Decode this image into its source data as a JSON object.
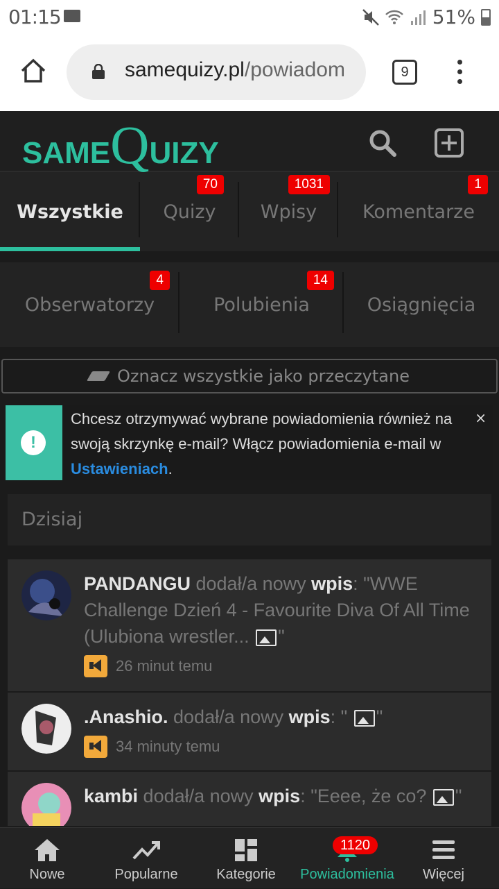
{
  "status_bar": {
    "time": "01:15",
    "battery": "51%"
  },
  "browser": {
    "url_domain": "samequizy.pl",
    "url_path": "/powiadom",
    "tab_count": "9"
  },
  "site": {
    "logo_same": "SAME",
    "logo_q": "Q",
    "logo_rest": "UIZY",
    "accent": "#2dbf9e"
  },
  "tabs_row1": [
    {
      "label": "Wszystkie",
      "badge": ""
    },
    {
      "label": "Quizy",
      "badge": "70"
    },
    {
      "label": "Wpisy",
      "badge": "1031"
    },
    {
      "label": "Komentarze",
      "badge": "1"
    }
  ],
  "tabs_row2": [
    {
      "label": "Obserwatorzy",
      "badge": "4"
    },
    {
      "label": "Polubienia",
      "badge": "14"
    },
    {
      "label": "Osiągnięcia",
      "badge": ""
    }
  ],
  "mark_all": "Oznacz wszystkie jako przeczytane",
  "notice": {
    "text_before": "Chcesz otrzymywać wybrane powiadomienia również na swoją skrzynkę e-mail? Włącz powiadomienia e-mail w ",
    "link": "Ustawieniach",
    "text_after": ".",
    "close": "×"
  },
  "section_today": "Dzisiaj",
  "feed": [
    {
      "user": "PANDANGU",
      "action": " dodał/a nowy ",
      "type": "wpis",
      "content_pre": ": \"WWE Challenge Dzień 4 - Favourite Diva Of All Time (Ulubiona wrestler... ",
      "content_post": "\"",
      "time": "26 minut temu"
    },
    {
      "user": ".Anashio.",
      "action": " dodał/a nowy ",
      "type": "wpis",
      "content_pre": ": \" ",
      "content_post": "\"",
      "time": "34 minuty temu"
    },
    {
      "user": "kambi",
      "action": " dodał/a nowy ",
      "type": "wpis",
      "content_pre": ": \"Eeee, że co? ",
      "content_post": "\"",
      "time": ""
    }
  ],
  "bottom_nav": [
    {
      "label": "Nowe",
      "icon": "home-icon"
    },
    {
      "label": "Popularne",
      "icon": "trending-icon"
    },
    {
      "label": "Kategorie",
      "icon": "categories-icon"
    },
    {
      "label": "Powiadomienia",
      "icon": "bell-icon",
      "badge": "1120"
    },
    {
      "label": "Więcej",
      "icon": "menu-icon"
    }
  ]
}
